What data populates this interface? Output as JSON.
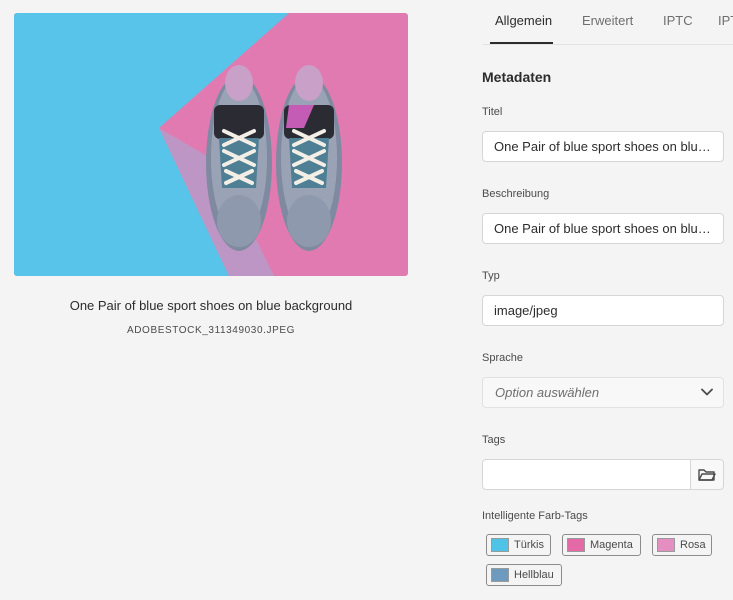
{
  "preview": {
    "title": "One Pair of blue sport shoes on blue background",
    "filename": "ADOBESTOCK_311349030.JPEG"
  },
  "tabs": [
    {
      "label": "Allgemein"
    },
    {
      "label": "Erweitert"
    },
    {
      "label": "IPTC"
    },
    {
      "label": "IPTC"
    }
  ],
  "metadata": {
    "section_title": "Metadaten",
    "title_label": "Titel",
    "title_value": "One Pair of blue sport shoes on blue...",
    "description_label": "Beschreibung",
    "description_value": "One Pair of blue sport shoes on blue...",
    "type_label": "Typ",
    "type_value": "image/jpeg",
    "language_label": "Sprache",
    "language_placeholder": "Option auswählen",
    "tags_label": "Tags",
    "smart_tags_label": "Intelligente Farb-Tags"
  },
  "color_tags": [
    {
      "label": "Türkis",
      "color": "#4fc3e6"
    },
    {
      "label": "Magenta",
      "color": "#e46aa7"
    },
    {
      "label": "Rosa",
      "color": "#e58ec2"
    },
    {
      "label": "Hellblau",
      "color": "#6f9ac0"
    }
  ],
  "icons": {
    "language_dropdown": "chevron-down-icon",
    "tags_browse": "folder-icon"
  }
}
